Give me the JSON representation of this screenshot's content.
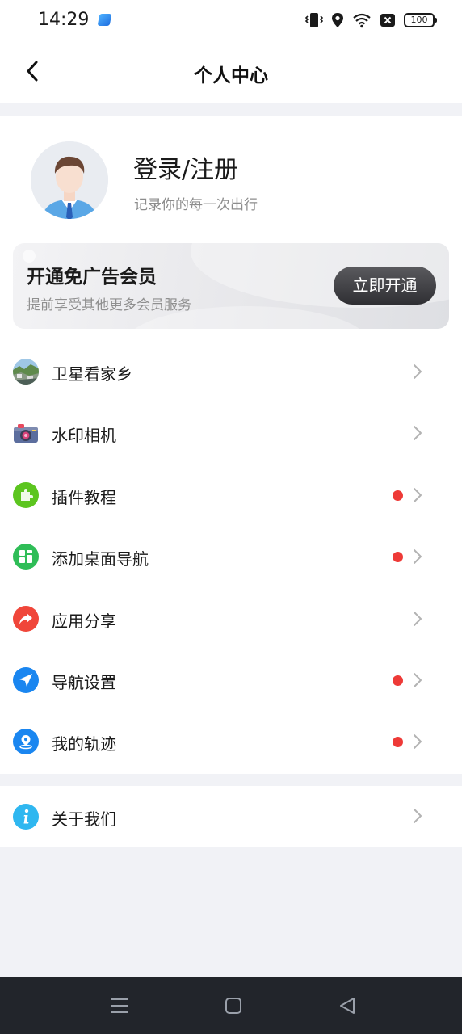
{
  "status_bar": {
    "time": "14:29",
    "battery": "100",
    "icons": [
      "app-icon",
      "vibrate-icon",
      "location-icon",
      "wifi-icon",
      "no-sim-icon",
      "battery-icon"
    ]
  },
  "header": {
    "title": "个人中心",
    "back_icon": "chevron-left-icon"
  },
  "profile": {
    "login_label": "登录/注册",
    "subtitle": "记录你的每一次出行",
    "avatar_icon": "user-avatar-icon"
  },
  "vip": {
    "title": "开通免广告会员",
    "subtitle": "提前享受其他更多会员服务",
    "button_label": "立即开通"
  },
  "menu": [
    {
      "label": "卫星看家乡",
      "icon": "satellite-landscape-icon",
      "badge": false
    },
    {
      "label": "水印相机",
      "icon": "camera-icon",
      "badge": false
    },
    {
      "label": "插件教程",
      "icon": "puzzle-icon",
      "badge": true
    },
    {
      "label": "添加桌面导航",
      "icon": "grid-icon",
      "badge": true
    },
    {
      "label": "应用分享",
      "icon": "share-icon",
      "badge": false
    },
    {
      "label": "导航设置",
      "icon": "navigation-arrow-icon",
      "badge": true
    },
    {
      "label": "我的轨迹",
      "icon": "location-pin-icon",
      "badge": true
    }
  ],
  "about": {
    "label": "关于我们",
    "icon": "info-icon"
  },
  "colors": {
    "badge_red": "#ee3a37",
    "page_bg": "#f1f2f6",
    "puzzle_green": "#5cc51f",
    "grid_green": "#2fbd57",
    "share_red": "#f0463a",
    "nav_blue": "#1a86f0",
    "info_blue": "#2fb7f0"
  },
  "system_nav": [
    "menu-icon",
    "home-icon",
    "back-icon"
  ]
}
